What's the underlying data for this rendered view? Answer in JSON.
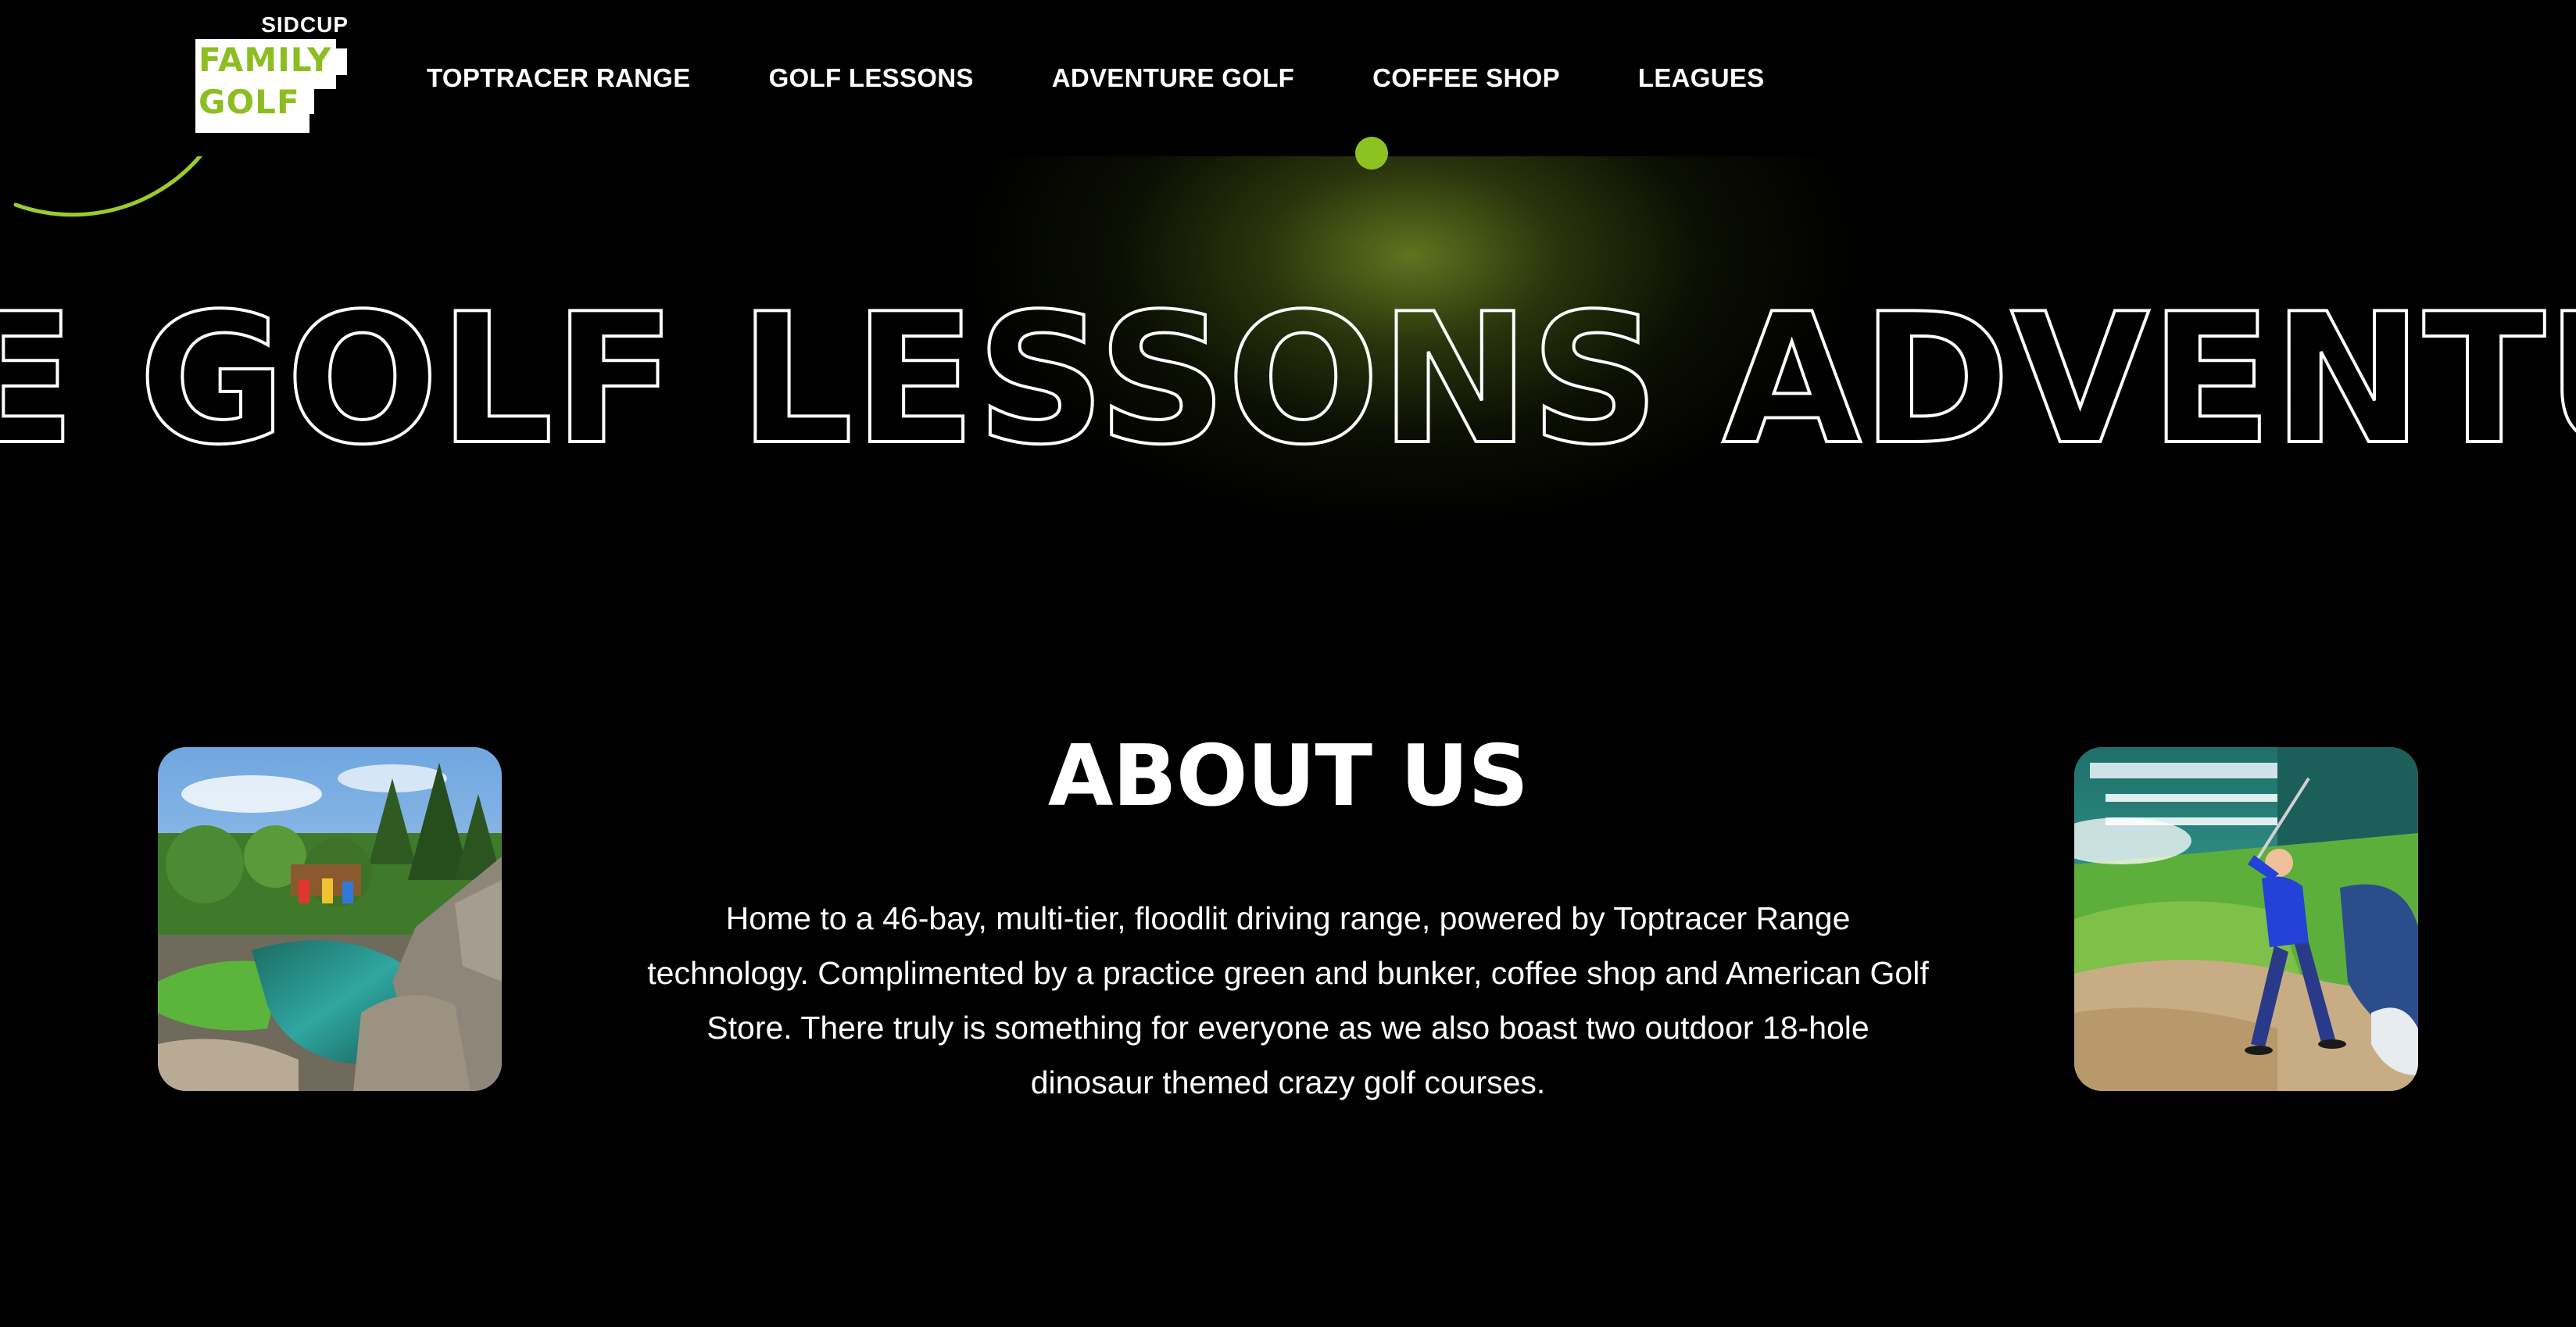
{
  "header": {
    "logo": {
      "top_text": "SIDCUP",
      "line1": "FAMILY",
      "line2": "GOLF"
    },
    "nav": [
      {
        "label": "TOPTRACER RANGE"
      },
      {
        "label": "GOLF LESSONS"
      },
      {
        "label": "ADVENTURE GOLF"
      },
      {
        "label": "COFFEE SHOP"
      },
      {
        "label": "LEAGUES"
      }
    ],
    "active_nav": "COFFEE SHOP"
  },
  "marquee": {
    "text": "E GOLF LESSONS ADVENTU"
  },
  "about": {
    "title": "ABOUT US",
    "body": "Home to a 46-bay, multi-tier, floodlit driving range, powered by Toptracer Range technology. Complimented by a practice green and bunker, coffee shop and American Golf Store. There truly is something for everyone as we also boast two outdoor 18-hole dinosaur themed crazy golf courses."
  },
  "images": {
    "left": {
      "subject": "adventure-golf-course-photo"
    },
    "right": {
      "subject": "golfer-swinging-at-range-photo"
    }
  },
  "colors": {
    "background": "#000000",
    "accent": "#8cc21f",
    "text": "#ffffff"
  }
}
